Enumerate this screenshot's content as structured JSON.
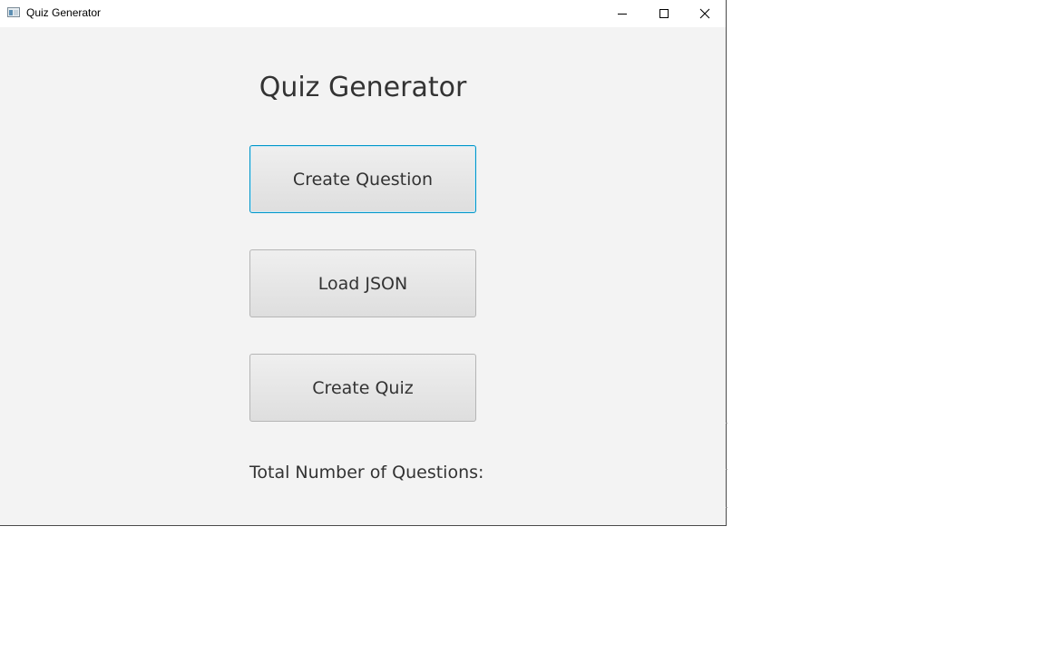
{
  "window": {
    "title": "Quiz Generator",
    "minimize_icon": "minimize-icon",
    "maximize_icon": "maximize-icon",
    "close_icon": "close-icon"
  },
  "main": {
    "heading": "Quiz Generator",
    "buttons": [
      {
        "label": "Create Question",
        "focused": true
      },
      {
        "label": "Load JSON",
        "focused": false
      },
      {
        "label": "Create Quiz",
        "focused": false
      }
    ],
    "total_questions_label": "Total Number of Questions:"
  },
  "colors": {
    "background": "#f3f3f3",
    "focus_border": "#0096c9",
    "text": "#333333"
  }
}
